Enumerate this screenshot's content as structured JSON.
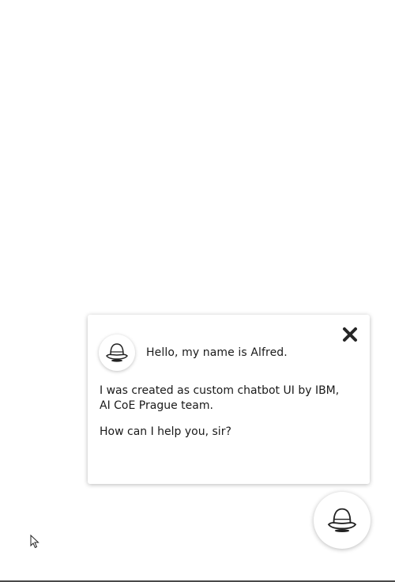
{
  "chat": {
    "greeting": "Hello, my name is Alfred.",
    "intro": "I was created as custom chatbot UI by IBM, AI CoE Prague team.",
    "question": "How can I help you, sir?"
  },
  "icons": {
    "close": "close-icon",
    "avatar": "bowler-hat-icon",
    "launcher": "bowler-hat-icon",
    "cursor": "mouse-pointer-icon"
  },
  "colors": {
    "text": "#1a1a1a",
    "close_icon": "#262626",
    "background": "#ffffff"
  }
}
